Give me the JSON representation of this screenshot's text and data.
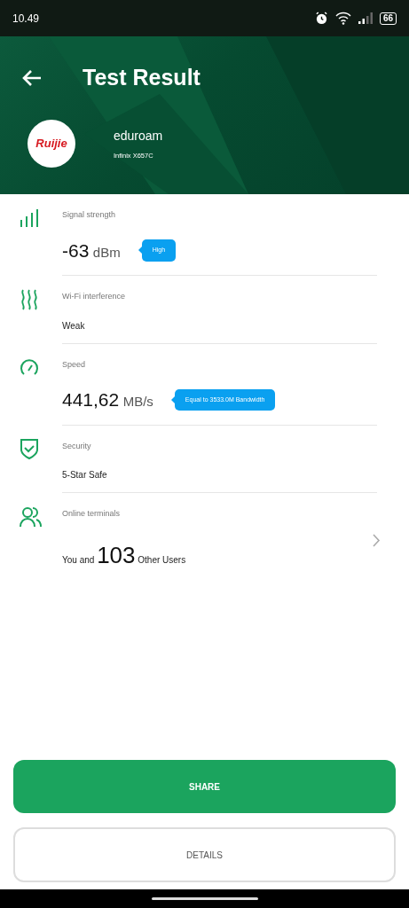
{
  "status_bar": {
    "time": "10.49",
    "battery": "66"
  },
  "header": {
    "title": "Test Result",
    "network": "eduroam",
    "device": "Infinix X657C",
    "logo_text": "Ruijie"
  },
  "rows": [
    {
      "kind": "measure",
      "label": "Signal strength",
      "value": "-63",
      "unit": "dBm",
      "badge": "High"
    },
    {
      "kind": "text",
      "label": "Wi-Fi interference",
      "value": "Weak"
    },
    {
      "kind": "measure",
      "label": "Speed",
      "value": "441,62",
      "unit": "MB/s",
      "badge": "Equal to 3533.0M Bandwidth"
    },
    {
      "kind": "text",
      "label": "Security",
      "value": "5-Star Safe"
    },
    {
      "kind": "count",
      "label": "Online terminals",
      "prefix": "You and",
      "value": "103",
      "suffix": "Other Users"
    }
  ],
  "buttons": [
    {
      "label": "SHARE",
      "primary": true
    },
    {
      "label": "DETAILS",
      "primary": false
    }
  ]
}
